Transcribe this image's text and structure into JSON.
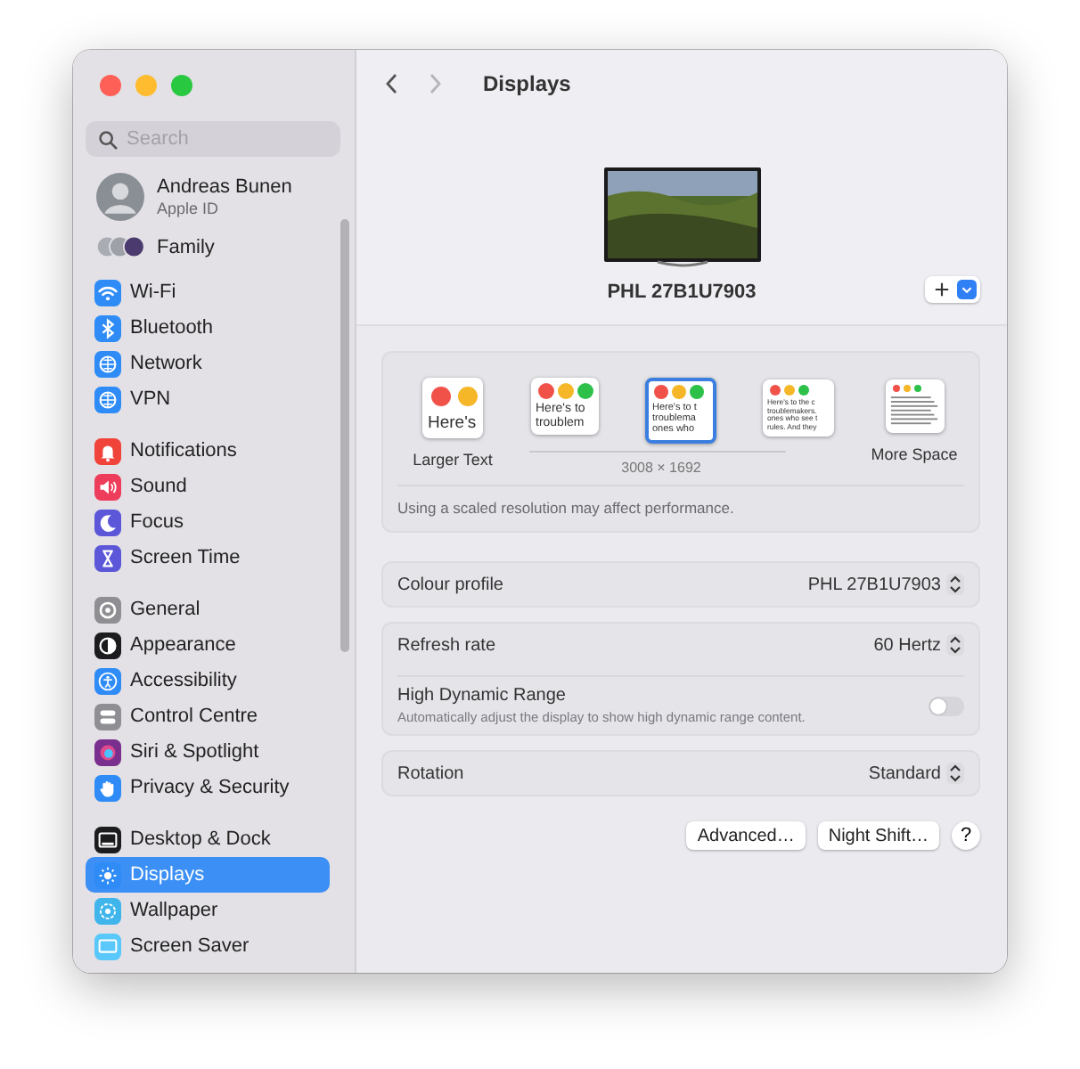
{
  "sidebar": {
    "search": {
      "placeholder": "Search"
    },
    "account": {
      "name": "Andreas Bunen",
      "subtitle": "Apple ID"
    },
    "family": {
      "label": "Family"
    },
    "groups": [
      [
        {
          "label": "Wi-Fi",
          "kind": "wifi",
          "color": "#2f8cf6",
          "selected": false
        },
        {
          "label": "Bluetooth",
          "kind": "bluetooth",
          "color": "#2f8cf6",
          "selected": false
        },
        {
          "label": "Network",
          "kind": "globe",
          "color": "#2f8cf6",
          "selected": false
        },
        {
          "label": "VPN",
          "kind": "globe",
          "color": "#2f8cf6",
          "selected": false
        }
      ],
      [
        {
          "label": "Notifications",
          "kind": "bell",
          "color": "#f0443a",
          "selected": false
        },
        {
          "label": "Sound",
          "kind": "speaker",
          "color": "#ee3d5b",
          "selected": false
        },
        {
          "label": "Focus",
          "kind": "moon",
          "color": "#5b57d8",
          "selected": false
        },
        {
          "label": "Screen Time",
          "kind": "hourglass",
          "color": "#5b57d8",
          "selected": false
        }
      ],
      [
        {
          "label": "General",
          "kind": "gear",
          "color": "#8e8e93",
          "selected": false
        },
        {
          "label": "Appearance",
          "kind": "contrast",
          "color": "#1c1c1e",
          "selected": false
        },
        {
          "label": "Accessibility",
          "kind": "accessibility",
          "color": "#2f8cf6",
          "selected": false
        },
        {
          "label": "Control Centre",
          "kind": "toggles",
          "color": "#8e8e93",
          "selected": false
        },
        {
          "label": "Siri & Spotlight",
          "kind": "orb",
          "color": "#7a2f8e",
          "selected": false
        },
        {
          "label": "Privacy & Security",
          "kind": "hand",
          "color": "#2f8cf6",
          "selected": false
        }
      ],
      [
        {
          "label": "Desktop & Dock",
          "kind": "dock",
          "color": "#1c1c1e",
          "selected": false
        },
        {
          "label": "Displays",
          "kind": "sun",
          "color": "#2f8cf6",
          "selected": true
        },
        {
          "label": "Wallpaper",
          "kind": "flower",
          "color": "#3fb5ec",
          "selected": false
        },
        {
          "label": "Screen Saver",
          "kind": "screen",
          "color": "#5ac8fa",
          "selected": false
        }
      ]
    ]
  },
  "header": {
    "title": "Displays"
  },
  "display": {
    "name": "PHL 27B1U7903"
  },
  "resolution": {
    "options": [
      {
        "kind": "text",
        "lines": [
          "Here's"
        ],
        "caption": "Larger Text",
        "selected": false
      },
      {
        "kind": "text",
        "lines": [
          "Here's to",
          "troublem"
        ],
        "selected": false
      },
      {
        "kind": "text",
        "lines": [
          "Here's to t",
          "troublema",
          "ones who"
        ],
        "selected": true
      },
      {
        "kind": "text",
        "lines": [
          "Here's to the c",
          "troublemakers.",
          "ones who see t",
          "rules. And they"
        ],
        "selected": false
      },
      {
        "kind": "tiny",
        "caption": "More Space",
        "selected": false
      }
    ],
    "reading": "3008 × 1692",
    "note": "Using a scaled resolution may affect performance."
  },
  "settings": [
    [
      {
        "kind": "popup",
        "label": "Colour profile",
        "value": "PHL 27B1U7903"
      }
    ],
    [
      {
        "kind": "popup",
        "label": "Refresh rate",
        "value": "60 Hertz"
      },
      {
        "kind": "toggle",
        "label": "High Dynamic Range",
        "description": "Automatically adjust the display to show high dynamic range content.",
        "on": false
      }
    ],
    [
      {
        "kind": "popup",
        "label": "Rotation",
        "value": "Standard"
      }
    ]
  ],
  "buttons": [
    {
      "kind": "text",
      "label": "Advanced…"
    },
    {
      "kind": "text",
      "label": "Night Shift…"
    },
    {
      "kind": "help",
      "label": "?"
    }
  ]
}
